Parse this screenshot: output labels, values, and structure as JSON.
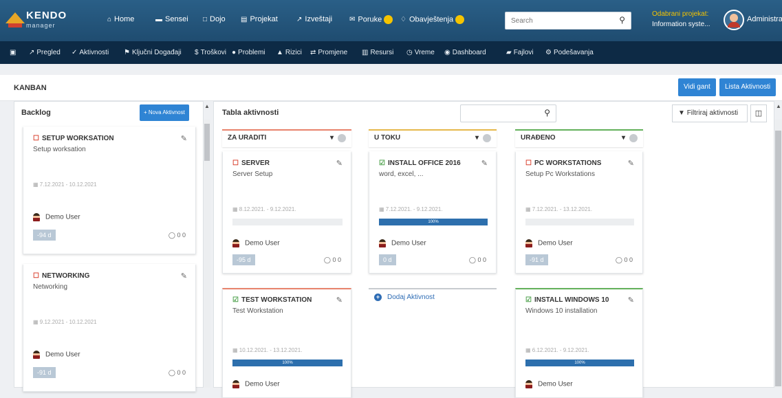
{
  "header": {
    "logo_title": "KENDO",
    "logo_sub": "manager",
    "nav": [
      {
        "icon": "home-icon",
        "glyph": "⌂",
        "label": "Home"
      },
      {
        "icon": "briefcase-icon",
        "glyph": "▬",
        "label": "Sensei"
      },
      {
        "icon": "square-icon",
        "glyph": "□",
        "label": "Dojo"
      },
      {
        "icon": "document-icon",
        "glyph": "▤",
        "label": "Projekat"
      },
      {
        "icon": "chart-icon",
        "glyph": "↗",
        "label": "Izveštaji"
      },
      {
        "icon": "envelope-icon",
        "glyph": "✉",
        "label": "Poruke"
      },
      {
        "icon": "bell-icon",
        "glyph": "♢",
        "label": "Obavještenja"
      }
    ],
    "search_placeholder": "Search",
    "project_label": "Odabrani projekat:",
    "project_value": "Information syste...",
    "user": "Administrat"
  },
  "subnav": [
    {
      "icon": "chart-icon",
      "glyph": "↗",
      "label": "Pregled"
    },
    {
      "icon": "tasks-icon",
      "glyph": "✓",
      "label": "Aktivnosti"
    },
    {
      "icon": "flag-icon",
      "glyph": "⚑",
      "label": "Ključni Događaji"
    },
    {
      "icon": "dollar-icon",
      "glyph": "$",
      "label": "Troškovi"
    },
    {
      "icon": "alert-icon",
      "glyph": "●",
      "label": "Problemi"
    },
    {
      "icon": "warning-icon",
      "glyph": "▲",
      "label": "Rizici"
    },
    {
      "icon": "exchange-icon",
      "glyph": "⇄",
      "label": "Promjene"
    },
    {
      "icon": "bank-icon",
      "glyph": "▥",
      "label": "Resursi"
    },
    {
      "icon": "clock-icon",
      "glyph": "◷",
      "label": "Vreme"
    },
    {
      "icon": "dashboard-icon",
      "glyph": "◉",
      "label": "Dashboard"
    },
    {
      "icon": "folder-icon",
      "glyph": "▰",
      "label": "Fajlovi"
    },
    {
      "icon": "cogs-icon",
      "glyph": "⚙",
      "label": "Podešavanja"
    }
  ],
  "page": {
    "title": "KANBAN",
    "gantt_btn": "Vidi gant",
    "list_btn": "Lista Aktivnosti"
  },
  "backlog": {
    "title": "Backlog",
    "new_btn": "+ Nova Aktivnost",
    "cards": [
      {
        "title": "SETUP WORKSATION",
        "desc": "Setup worksation",
        "date": "7.12.2021 - 10.12.2021",
        "user": "Demo User",
        "days": "-94 d",
        "meta": "0 0"
      },
      {
        "title": "NETWORKING",
        "desc": "Networking",
        "date": "9.12.2021 - 10.12.2021",
        "user": "Demo User",
        "days": "-91 d",
        "meta": "0 0"
      }
    ]
  },
  "board": {
    "title": "Tabla aktivnosti",
    "filter": "Filtriraj aktivnosti",
    "add_activity": "Dodaj Aktivnost",
    "columns": [
      {
        "name": "ZA URADITI",
        "color": "#e8826b"
      },
      {
        "name": "U TOKU",
        "color": "#e6b84a"
      },
      {
        "name": "URAĐENO",
        "color": "#62b05a"
      }
    ],
    "cards": [
      {
        "title": "SERVER",
        "desc": "Server Setup",
        "date": "8.12.2021. - 9.12.2021.",
        "user": "Demo User",
        "days": "-95 d",
        "meta": "0 0",
        "progress": 0
      },
      {
        "title": "INSTALL OFFICE 2016",
        "desc": "word, excel, ...",
        "date": "7.12.2021. - 9.12.2021.",
        "user": "Demo User",
        "days": "0 d",
        "meta": "0 0",
        "progress": 100,
        "progress_label": "100%"
      },
      {
        "title": "PC WORKSTATIONS",
        "desc": "Setup Pc Workstations",
        "date": "7.12.2021. - 13.12.2021.",
        "user": "Demo User",
        "days": "-91 d",
        "meta": "0 0",
        "progress": 0
      },
      {
        "title": "TEST WORKSTATION",
        "desc": "Test Workstation",
        "date": "10.12.2021. - 13.12.2021.",
        "user": "Demo User",
        "progress": 100,
        "progress_label": "100%"
      },
      {
        "title": "INSTALL WINDOWS 10",
        "desc": "Windows 10 installation",
        "date": "6.12.2021. - 9.12.2021.",
        "user": "Demo User",
        "progress": 100,
        "progress_label": "100%"
      }
    ]
  }
}
